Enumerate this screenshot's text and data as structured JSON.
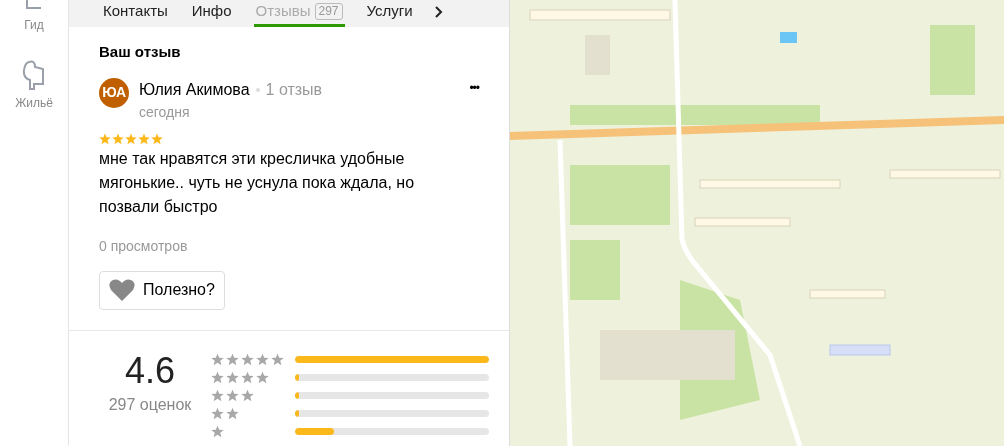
{
  "sidebar": {
    "items": [
      {
        "label": "Гид",
        "kind": "guide"
      },
      {
        "label": "Жильё",
        "kind": "housing"
      }
    ]
  },
  "tabs": [
    {
      "label": "Контакты",
      "selected": false
    },
    {
      "label": "Инфо",
      "selected": false
    },
    {
      "label": "Отзывы",
      "count": "297",
      "selected": true
    },
    {
      "label": "Услуги",
      "selected": false
    }
  ],
  "your_review": {
    "heading": "Ваш отзыв",
    "author": {
      "initials": "ЮА",
      "name": "Юлия Акимова",
      "reviews": "1 отзыв"
    },
    "date": "сегодня",
    "more": "•••",
    "stars": 5,
    "text": "мне так нравятся эти кресличка удобные мягонькие.. чуть не уснула пока ждала, но позвали быстро",
    "views": "0 просмотров",
    "helpful_button": "Полезно?"
  },
  "rating_summary": {
    "score": "4.6",
    "count": "297 оценок",
    "distribution": [
      {
        "kind": "five",
        "level": 1.0
      },
      {
        "kind": "four",
        "level": 0.02
      },
      {
        "kind": "three",
        "level": 0.02
      },
      {
        "kind": "two",
        "level": 0.02
      },
      {
        "kind": "one",
        "level": 0.2
      }
    ]
  }
}
